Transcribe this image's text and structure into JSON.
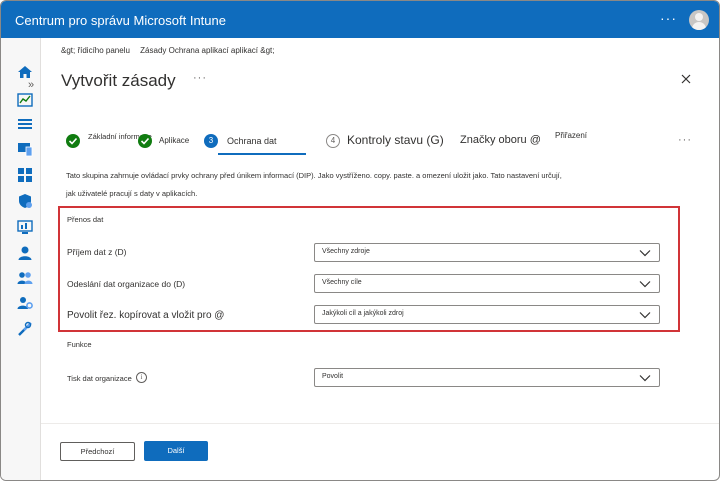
{
  "app": {
    "title": "Centrum pro správu Microsoft Intune",
    "more_label": "···"
  },
  "sidebar": {
    "collapse_label": "»",
    "icons": [
      "home-icon",
      "dashboard-icon",
      "list-icon",
      "devices-icon",
      "apps-icon",
      "endpoint-security-icon",
      "reports-icon",
      "users-icon",
      "groups-icon",
      "tenant-admin-icon",
      "troubleshooting-icon"
    ]
  },
  "breadcrumb": {
    "items": [
      "&gt; řídicího panelu",
      "Zásady Ochrana aplikací aplikací &gt;"
    ]
  },
  "page": {
    "title": "Vytvořit zásady",
    "more_label": "···"
  },
  "steps": [
    {
      "label": "Základní informace",
      "state": "done"
    },
    {
      "label": "Aplikace",
      "state": "done"
    },
    {
      "number": "3",
      "label": "Ochrana dat",
      "state": "active"
    },
    {
      "number": "4",
      "label": "Kontroly stavu (G)",
      "state": "pending"
    },
    {
      "label": "Značky oboru @",
      "state": "pending"
    },
    {
      "label": "Přiřazení",
      "state": "pending"
    }
  ],
  "steps_more_label": "···",
  "description": "Tato skupina zahrnuje ovládací prvky ochrany před únikem informací (DIP). Jako vystříženo. copy. paste. a omezení uložit jako. Tato nastavení určují, jak uživatelé pracují s daty v aplikacích.",
  "data_transfer": {
    "section_label": "Přenos dat",
    "rows": [
      {
        "label": "Příjem dat z (D)",
        "value": "Všechny zdroje"
      },
      {
        "label": "Odeslání dat organizace do (D)",
        "value": "Všechny cíle"
      },
      {
        "label": "Povolit řez. kopírovat a vložit pro @",
        "value": "Jakýkoli cíl a jakýkoli zdroj"
      }
    ]
  },
  "functions": {
    "section_label": "Funkce",
    "rows": [
      {
        "label": "Tisk dat organizace",
        "value": "Povolit",
        "info_icon": "i"
      }
    ]
  },
  "footer": {
    "previous_label": "Předchozí",
    "next_label": "Další"
  },
  "colors": {
    "brand": "#0f6cbd",
    "done": "#107c10",
    "highlight": "#d13438"
  }
}
